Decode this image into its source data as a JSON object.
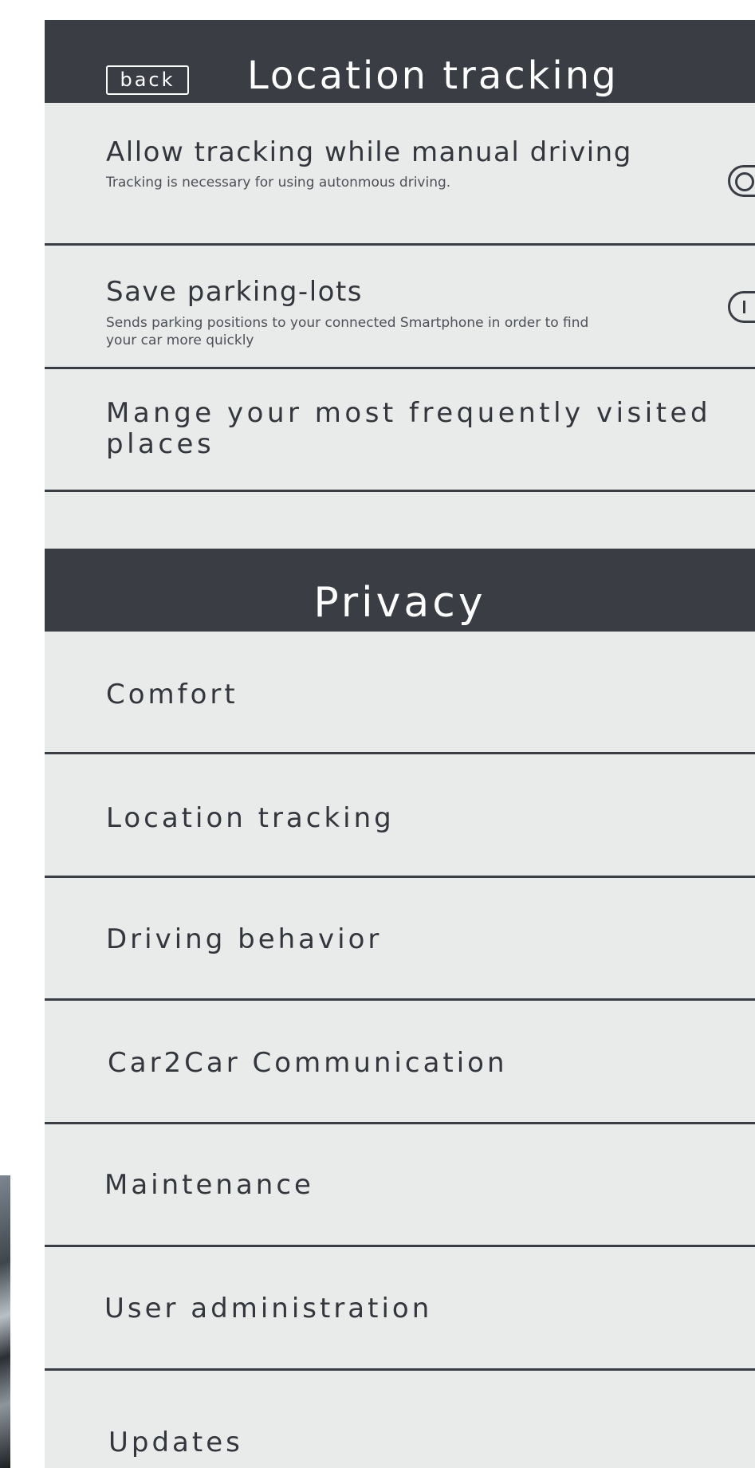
{
  "header": {
    "back_label": "back",
    "title": "Location tracking"
  },
  "settings": [
    {
      "title": "Allow tracking while manual driving",
      "description": "Tracking is necessary for using autonmous driving.",
      "toggle": "off"
    },
    {
      "title": "Save parking-lots",
      "description": "Sends parking positions to your connected Smartphone in order to find your car more quickly",
      "toggle": "on"
    }
  ],
  "manage_places": {
    "label_line1": "Mange your most frequently visited",
    "label_line2": "places"
  },
  "privacy": {
    "title": "Privacy",
    "items": [
      "Comfort",
      "Location tracking",
      "Driving behavior",
      "Car2Car Communication",
      "Maintenance",
      "User administration",
      "Updates"
    ]
  },
  "colors": {
    "header_bg": "#3a3d44",
    "panel_bg": "#e9eaea",
    "text": "#33363c"
  }
}
